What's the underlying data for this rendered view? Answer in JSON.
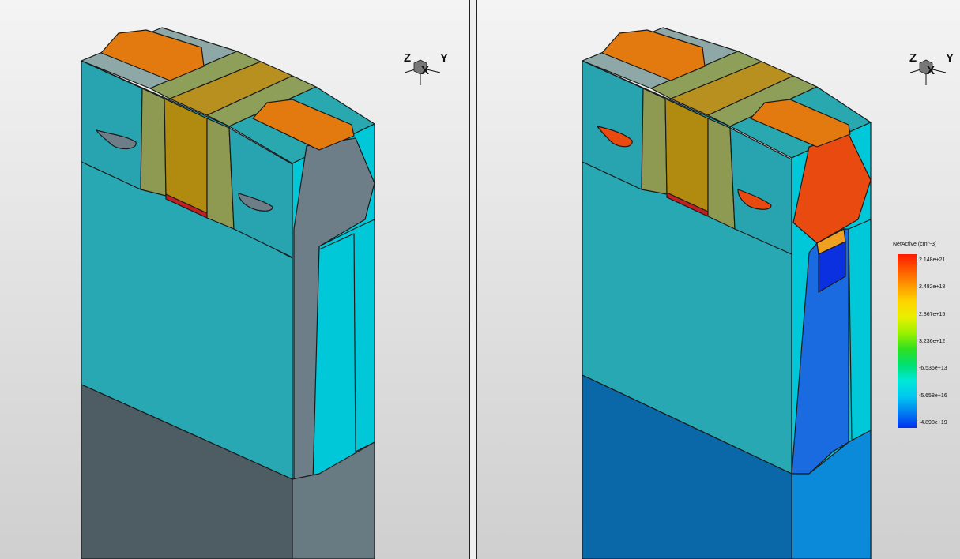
{
  "axes": {
    "z": "Z",
    "y": "Y",
    "x": "X"
  },
  "legend": {
    "title": "NetActive (cm^-3)",
    "ticks": [
      "2.148e+21",
      "2.482e+18",
      "2.867e+15",
      "3.236e+12",
      "-6.535e+13",
      "-5.658e+16",
      "-4.898e+19"
    ],
    "colors": [
      "#ff1a00",
      "#ff5a00",
      "#ff9a00",
      "#ffd400",
      "#e8f000",
      "#9af000",
      "#30e020",
      "#00e070",
      "#00e8d8",
      "#00c8f0",
      "#0080f0",
      "#0030f0"
    ]
  }
}
